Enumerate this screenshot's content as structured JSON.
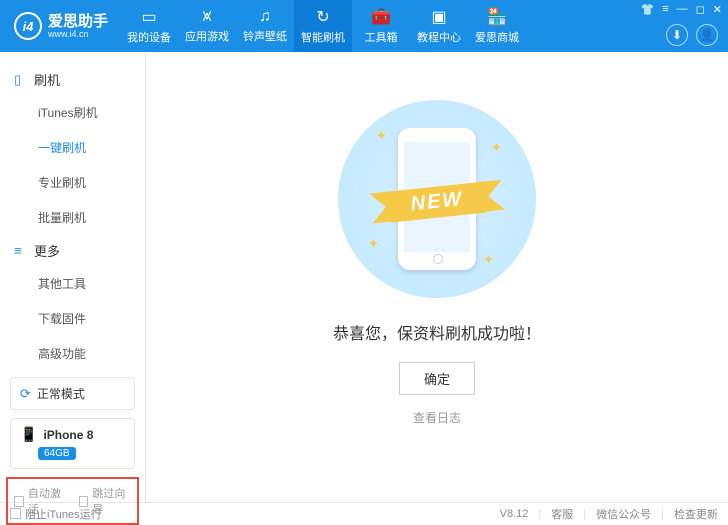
{
  "logo": {
    "mark": "i4",
    "title": "爱思助手",
    "sub": "www.i4.cn"
  },
  "nav": [
    {
      "icon": "▭",
      "label": "我的设备"
    },
    {
      "icon": "⩙",
      "label": "应用游戏"
    },
    {
      "icon": "♫",
      "label": "铃声壁纸"
    },
    {
      "icon": "↻",
      "label": "智能刷机"
    },
    {
      "icon": "🧰",
      "label": "工具箱"
    },
    {
      "icon": "▣",
      "label": "教程中心"
    },
    {
      "icon": "🏪",
      "label": "爱思商城"
    }
  ],
  "sidebar": {
    "group1": {
      "title": "刷机",
      "items": [
        "iTunes刷机",
        "一键刷机",
        "专业刷机",
        "批量刷机"
      ]
    },
    "group2": {
      "title": "更多",
      "items": [
        "其他工具",
        "下载固件",
        "高级功能"
      ]
    }
  },
  "mode": {
    "label": "正常模式"
  },
  "device": {
    "name": "iPhone 8",
    "storage": "64GB"
  },
  "options": {
    "auto_activate": "自动激活",
    "skip_guide": "跳过向导"
  },
  "main": {
    "ribbon": "NEW",
    "message": "恭喜您，保资料刷机成功啦！",
    "confirm": "确定",
    "log_link": "查看日志"
  },
  "footer": {
    "block_itunes": "阻止iTunes运行",
    "version": "V8.12",
    "support": "客服",
    "wechat": "微信公众号",
    "update": "检查更新"
  }
}
